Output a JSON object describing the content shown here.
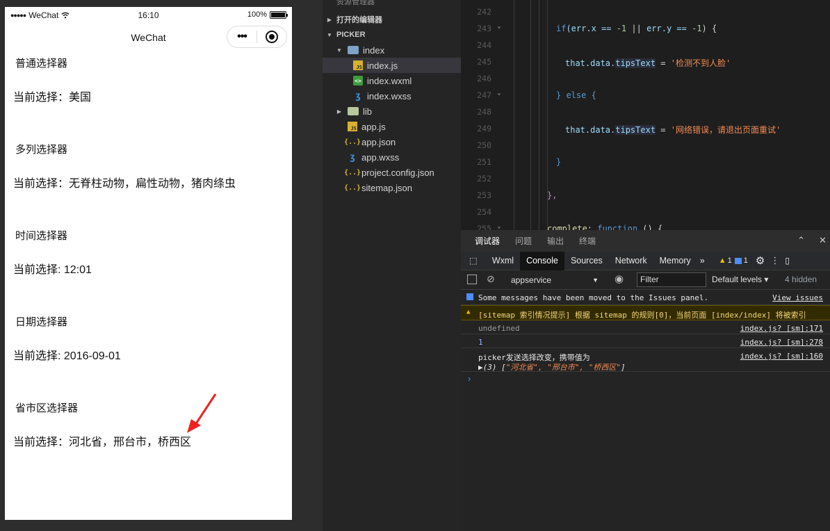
{
  "simulator": {
    "status_bar": {
      "dots": "●●●●●",
      "carrier": "WeChat",
      "time": "16:10",
      "battery": "100%",
      "battery_level": 1.0
    },
    "nav_title": "WeChat",
    "capsule_more": "•••",
    "sections": [
      {
        "title": "普通选择器",
        "value": "当前选择：美国"
      },
      {
        "title": "多列选择器",
        "value": "当前选择：无脊柱动物，扁性动物，猪肉绦虫"
      },
      {
        "title": "时间选择器",
        "value": "当前选择: 12:01"
      },
      {
        "title": "日期选择器",
        "value": "当前选择: 2016-09-01"
      },
      {
        "title": "省市区选择器",
        "value": "当前选择：河北省，邢台市，桥西区"
      }
    ],
    "arrow_color": "#ee2222"
  },
  "explorer": {
    "header": "资源管理器",
    "open_editors": "打开的编辑器",
    "project": "PICKER",
    "tree": [
      {
        "label": "index",
        "icon": "folder-open-icon"
      },
      {
        "label": "index.js",
        "icon": "js-file-icon"
      },
      {
        "label": "index.wxml",
        "icon": "wxml-file-icon"
      },
      {
        "label": "index.wxss",
        "icon": "css-file-icon"
      },
      {
        "label": "lib",
        "icon": "folder-icon"
      },
      {
        "label": "app.js",
        "icon": "js-file-icon"
      },
      {
        "label": "app.json",
        "icon": "json-file-icon"
      },
      {
        "label": "app.wxss",
        "icon": "css-file-icon"
      },
      {
        "label": "project.config.json",
        "icon": "json-file-icon"
      },
      {
        "label": "sitemap.json",
        "icon": "json-file-icon"
      }
    ]
  },
  "editor": {
    "line_numbers": [
      "242",
      "243",
      "244",
      "245",
      "246",
      "247",
      "248",
      "249",
      "250",
      "251",
      "252",
      "253",
      "254",
      "255"
    ],
    "code": {
      "l243_if": "if",
      "l243_cond_a": "(err.x == ",
      "l243_num1": "-1",
      "l243_or": " || ",
      "l243_cond_b": "err.y == ",
      "l243_num2": "-1",
      "l243_end": ") {",
      "l245_obj": "that.data.",
      "l245_prop": "tipsText",
      "l245_eq": " = ",
      "l245_str": "'检测不到人脸'",
      "l247": "} else {",
      "l249_obj": "that.data.",
      "l249_prop": "tipsText",
      "l249_eq": " = ",
      "l249_str": "'网络错误，请退出页面重试'",
      "l251": "}",
      "l253": "},",
      "l255_key": "complete",
      "l255_colon": ": ",
      "l255_fn": "function",
      "l255_rest": " () {"
    }
  },
  "devtools": {
    "tabs": [
      "调试器",
      "问题",
      "输出",
      "终端"
    ],
    "tools": [
      "Wxml",
      "Console",
      "Sources",
      "Network",
      "Memory"
    ],
    "more": "»",
    "warn_count": "1",
    "info_count": "1",
    "context": "appservice",
    "filter_placeholder": "Filter",
    "levels": "Default levels ▾",
    "hidden": "4 hidden",
    "messages": {
      "info_text": "Some messages have been moved to the Issues panel.",
      "info_link": "View issues",
      "warn_text": "[sitemap 索引情况提示] 根据 sitemap 的规则[0]，当前页面 [index/index] 将被索引",
      "m1_text": "undefined",
      "m1_link": "index.js? [sm]:171",
      "m2_text": "1",
      "m2_link": "index.js? [sm]:278",
      "m3_text": "picker发送选择改变，携带值为",
      "m3_link": "index.js? [sm]:160",
      "m3_array_prefix": "▶(3) [",
      "m3_array_values": "\"河北省\", \"邢台市\", \"桥西区\"",
      "m3_array_suffix": "]"
    },
    "prompt": "›"
  }
}
